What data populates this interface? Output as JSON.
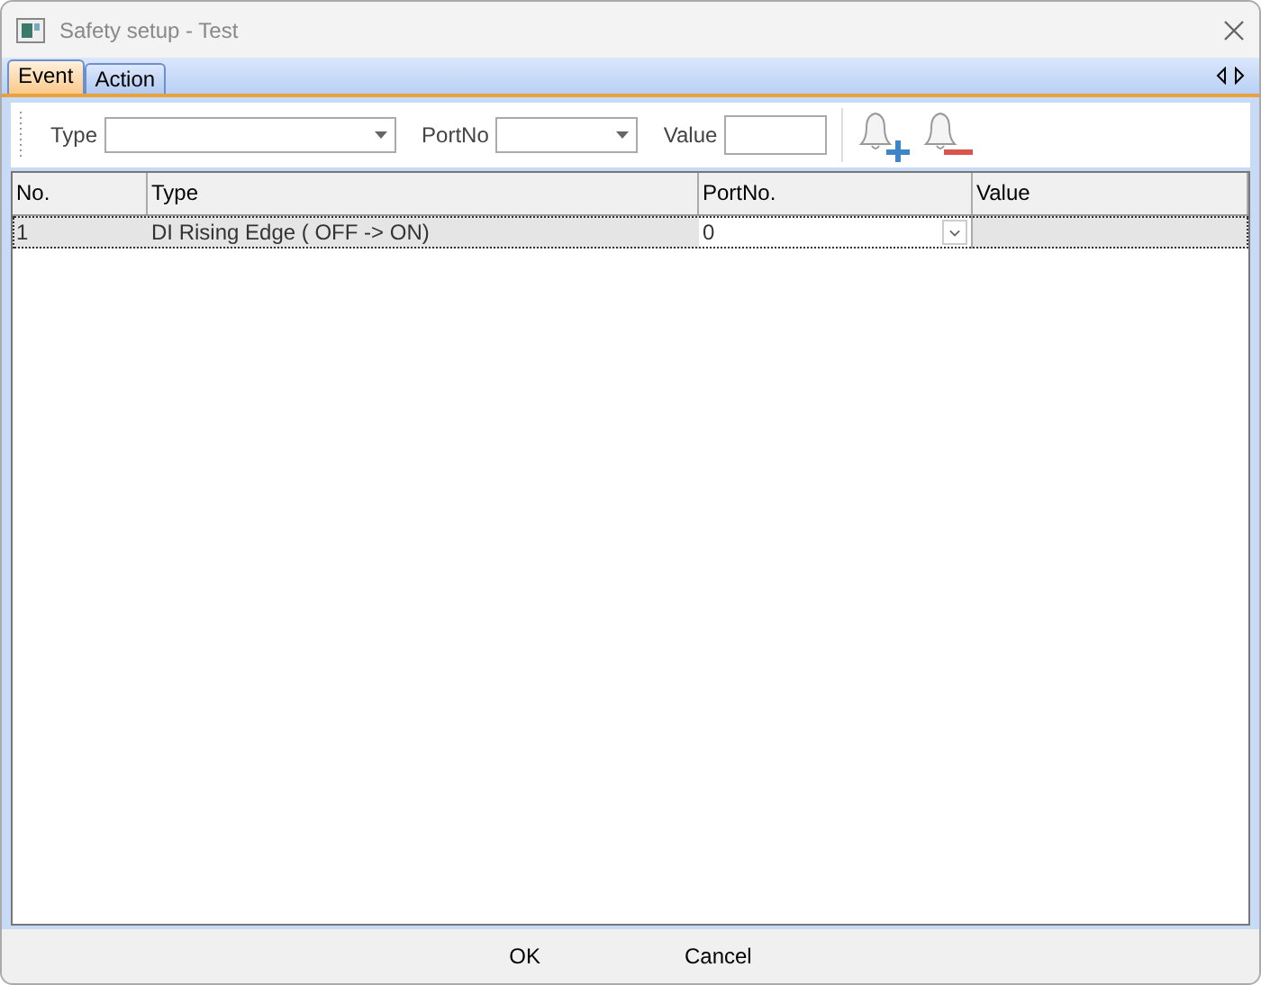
{
  "window": {
    "title": "Safety setup - Test"
  },
  "tabs": [
    {
      "label": "Event",
      "selected": true
    },
    {
      "label": "Action",
      "selected": false
    }
  ],
  "toolbar": {
    "type_label": "Type",
    "portno_label": "PortNo",
    "value_label": "Value"
  },
  "table": {
    "columns": [
      "No.",
      "Type",
      "PortNo.",
      "Value"
    ],
    "rows": [
      {
        "no": "1",
        "type": "DI Rising Edge ( OFF -> ON)",
        "portno": "0",
        "selected": true
      }
    ]
  },
  "buttons": [
    "OK",
    "Cancel"
  ]
}
